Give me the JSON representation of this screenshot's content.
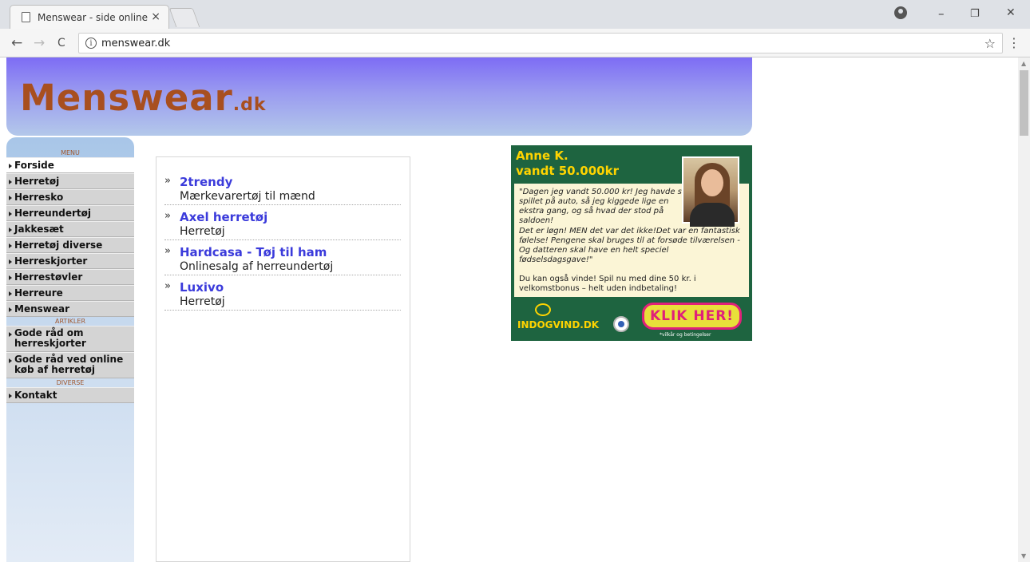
{
  "browser": {
    "tab_title": "Menswear - side online",
    "tab_close": "×",
    "url": "menswear.dk",
    "back": "←",
    "forward": "→",
    "reload": "C",
    "info": "i",
    "star": "☆",
    "menu": "⋮",
    "minimize": "–",
    "restore": "❐",
    "close": "✕"
  },
  "site": {
    "logo_main": "Menswear",
    "logo_tld": ".dk"
  },
  "sidebar": {
    "section_menu": "MENU",
    "menu_items": [
      {
        "label": "Forside"
      },
      {
        "label": "Herretøj"
      },
      {
        "label": "Herresko"
      },
      {
        "label": "Herreundertøj"
      },
      {
        "label": "Jakkesæt"
      },
      {
        "label": "Herretøj diverse"
      },
      {
        "label": "Herreskjorter"
      },
      {
        "label": "Herrestøvler"
      },
      {
        "label": "Herreure"
      },
      {
        "label": "Menswear"
      }
    ],
    "section_articles": "ARTIKLER",
    "article_items": [
      {
        "label": "Gode råd om herreskjorter"
      },
      {
        "label": "Gode råd ved online køb af herretøj"
      }
    ],
    "section_misc": "DIVERSE",
    "misc_items": [
      {
        "label": "Kontakt"
      }
    ]
  },
  "main": {
    "bullet": "»",
    "links": [
      {
        "title": "2trendy",
        "desc": "Mærkevarertøj til mænd"
      },
      {
        "title": "Axel herretøj",
        "desc": "Herretøj"
      },
      {
        "title": "Hardcasa - Tøj til ham",
        "desc": "Onlinesalg af herreundertøj"
      },
      {
        "title": "Luxivo",
        "desc": "Herretøj"
      }
    ]
  },
  "ad": {
    "headline_line1": "Anne K.",
    "headline_line2": "vandt 50.000kr",
    "quote_short": "\"Dagen jeg vandt 50.000 kr! Jeg havde sat spillet på auto, så jeg kiggede lige en ekstra gang, og så hvad der stod på saldoen!",
    "quote_long": "Det er løgn! MEN det var det ikke!Det var en fantastisk følelse! Pengene skal bruges til at forsøde tilværelsen - Og datteren skal have en helt speciel fødselsdagsgave!\"",
    "cta_text": "Du kan også vinde! Spil nu med dine 50 kr. i velkomstbonus – helt uden indbetaling!",
    "brand": "INDOGVIND.DK",
    "button_label": "KLIK HER!",
    "terms": "*vilkår og betingelser",
    "colors": {
      "background": "#1e6440",
      "headline": "#ffd400",
      "button": "#e8e03a",
      "button_text": "#e0207a"
    }
  }
}
